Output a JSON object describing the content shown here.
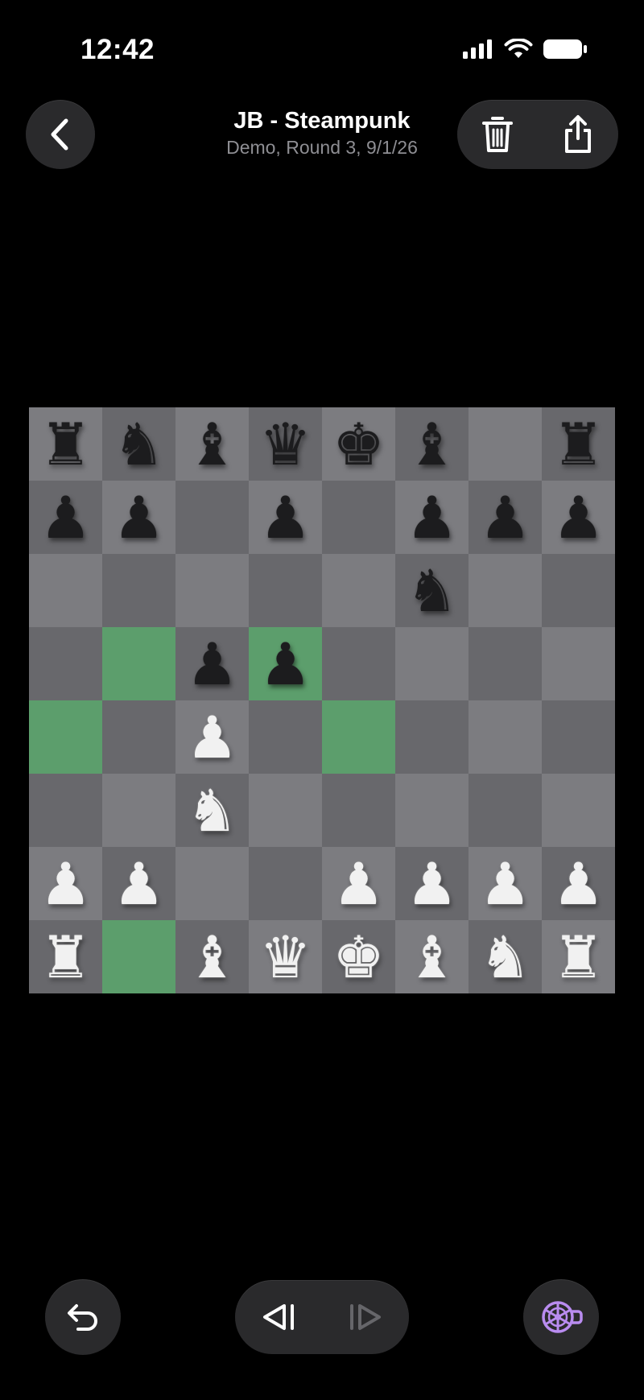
{
  "status": {
    "time": "12:42"
  },
  "nav": {
    "title": "JB - Steampunk",
    "subtitle": "Demo, Round 3, 9/1/26",
    "back_icon": "chevron-left-icon",
    "delete_icon": "trash-icon",
    "share_icon": "share-icon"
  },
  "colors": {
    "light": "#7c7c80",
    "dark": "#68686c",
    "highlight": "#5c9e6c",
    "engine_accent": "#b98cf0"
  },
  "board": {
    "ranks": [
      [
        "bR",
        "bN",
        "bB",
        "bQ",
        "bK",
        "bB",
        "",
        "bR"
      ],
      [
        "bP",
        "bP",
        "",
        "bP",
        "",
        "bP",
        "bP",
        "bP"
      ],
      [
        "",
        "",
        "",
        "",
        "",
        "bN",
        "",
        ""
      ],
      [
        "",
        "",
        "bP",
        "bP",
        "",
        "",
        "",
        ""
      ],
      [
        "",
        "",
        "wP",
        "",
        "",
        "",
        "",
        ""
      ],
      [
        "",
        "",
        "wN",
        "",
        "",
        "",
        "",
        ""
      ],
      [
        "wP",
        "wP",
        "",
        "",
        "wP",
        "wP",
        "wP",
        "wP"
      ],
      [
        "wR",
        "",
        "wB",
        "wQ",
        "wK",
        "wB",
        "wN",
        "wR"
      ]
    ],
    "highlighted": [
      "b5",
      "d5",
      "a4",
      "e4",
      "b1"
    ]
  },
  "controls": {
    "undo_icon": "undo-icon",
    "prev_icon": "step-back-icon",
    "next_icon": "step-forward-icon",
    "engine_icon": "steampunk-engine-icon"
  }
}
